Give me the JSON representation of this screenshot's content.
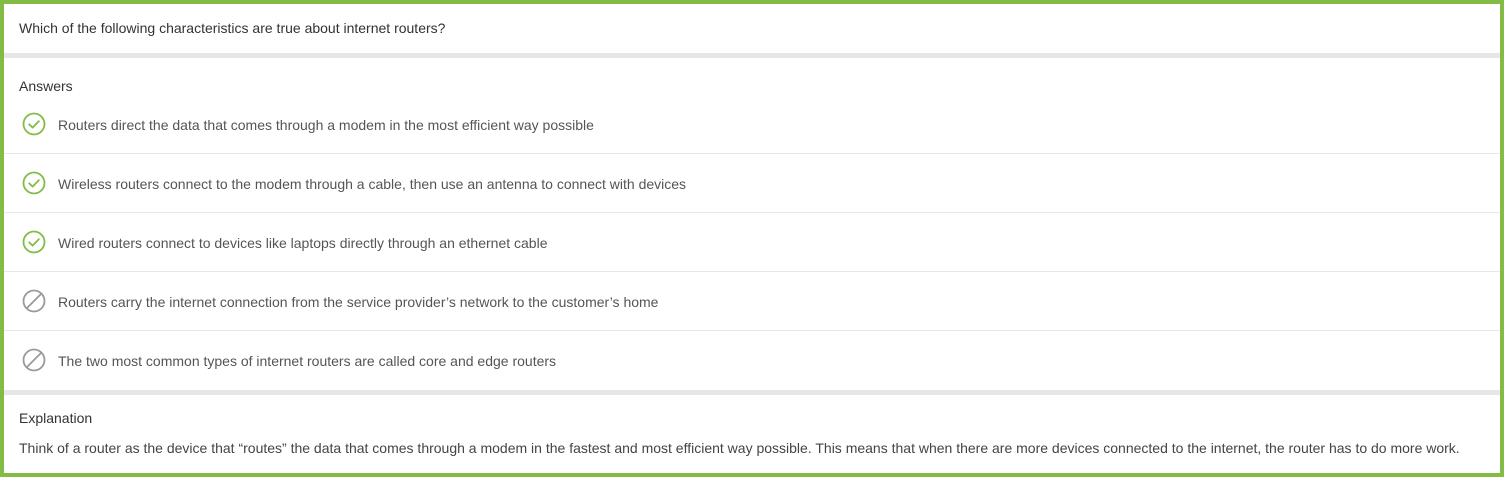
{
  "question": {
    "text": "Which of the following characteristics are true about internet routers?"
  },
  "answers": {
    "heading": "Answers",
    "items": [
      {
        "text": "Routers direct the data that comes through a modem in the most efficient way possible",
        "status": "correct",
        "icon": "check-circle-icon"
      },
      {
        "text": "Wireless routers connect to the modem through a cable, then use an antenna to connect with devices",
        "status": "correct",
        "icon": "check-circle-icon"
      },
      {
        "text": "Wired routers connect to devices like laptops directly through an ethernet cable",
        "status": "correct",
        "icon": "check-circle-icon"
      },
      {
        "text": "Routers carry the internet connection from the service provider’s network to the customer’s home",
        "status": "not-selected",
        "icon": "prohibited-circle-icon"
      },
      {
        "text": "The two most common types of internet routers are called core and edge routers",
        "status": "not-selected",
        "icon": "prohibited-circle-icon"
      }
    ]
  },
  "explanation": {
    "heading": "Explanation",
    "text": "Think of a router as the device that “routes” the data that comes through a modem in the fastest and most efficient way possible. This means that when there are more devices connected to the internet, the router has to do more work."
  },
  "colors": {
    "accent": "#82bc44",
    "correct": "#82bc44",
    "neutral": "#9a9a9a"
  }
}
